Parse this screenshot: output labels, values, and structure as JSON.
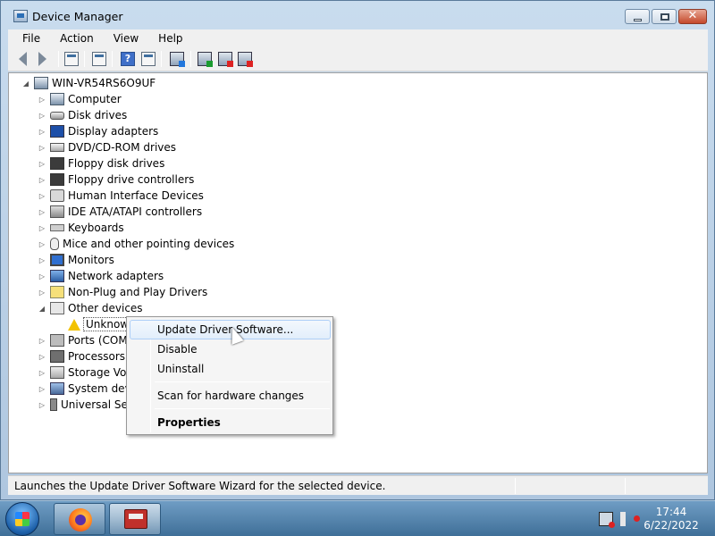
{
  "window": {
    "title": "Device Manager"
  },
  "menu": {
    "file": "File",
    "action": "Action",
    "view": "View",
    "help": "Help"
  },
  "tree": {
    "root": "WIN-VR54RS6O9UF",
    "items": [
      {
        "label": "Computer",
        "icon": "computer-icon"
      },
      {
        "label": "Disk drives",
        "icon": "disk-drive-icon"
      },
      {
        "label": "Display adapters",
        "icon": "display-adapter-icon"
      },
      {
        "label": "DVD/CD-ROM drives",
        "icon": "dvd-drive-icon"
      },
      {
        "label": "Floppy disk drives",
        "icon": "floppy-disk-icon"
      },
      {
        "label": "Floppy drive controllers",
        "icon": "floppy-controller-icon"
      },
      {
        "label": "Human Interface Devices",
        "icon": "hid-icon"
      },
      {
        "label": "IDE ATA/ATAPI controllers",
        "icon": "ide-controller-icon"
      },
      {
        "label": "Keyboards",
        "icon": "keyboard-icon"
      },
      {
        "label": "Mice and other pointing devices",
        "icon": "mouse-icon"
      },
      {
        "label": "Monitors",
        "icon": "monitor-icon"
      },
      {
        "label": "Network adapters",
        "icon": "network-adapter-icon"
      },
      {
        "label": "Non-Plug and Play Drivers",
        "icon": "npp-driver-icon"
      },
      {
        "label": "Other devices",
        "icon": "other-devices-icon"
      }
    ],
    "child_unknown": "Unknow",
    "after_items": [
      {
        "label": "Ports (COM",
        "icon": "ports-icon"
      },
      {
        "label": "Processors",
        "icon": "processor-icon"
      },
      {
        "label": "Storage Volu",
        "icon": "storage-icon"
      },
      {
        "label": "System devi",
        "icon": "system-device-icon"
      },
      {
        "label": "Universal Se",
        "icon": "usb-icon"
      }
    ]
  },
  "context_menu": {
    "update": "Update Driver Software...",
    "disable": "Disable",
    "uninstall": "Uninstall",
    "scan": "Scan for hardware changes",
    "properties": "Properties"
  },
  "status": {
    "text": "Launches the Update Driver Software Wizard for the selected device."
  },
  "taskbar": {
    "time": "17:44",
    "date": "6/22/2022"
  },
  "colors": {
    "accent": "#3f6f98",
    "selection": "#aecff7",
    "warning": "#f2c200"
  }
}
